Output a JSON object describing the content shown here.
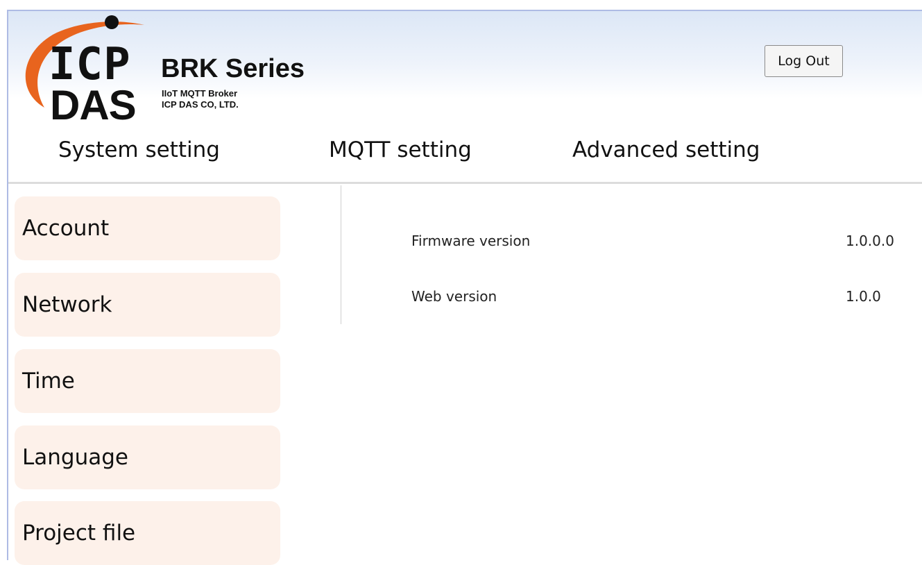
{
  "brand": {
    "logo_top": "ICP",
    "logo_bottom": "DAS",
    "title": "BRK Series",
    "subtitle_line1": "IIoT MQTT Broker",
    "subtitle_line2": "ICP DAS CO, LTD.",
    "swoosh_color": "#e8641e"
  },
  "header": {
    "logout_label": "Log Out"
  },
  "nav": {
    "tabs": [
      {
        "label": "System setting"
      },
      {
        "label": "MQTT setting"
      },
      {
        "label": "Advanced setting"
      }
    ]
  },
  "sidebar": {
    "items": [
      {
        "label": "Account"
      },
      {
        "label": "Network"
      },
      {
        "label": "Time"
      },
      {
        "label": "Language"
      },
      {
        "label": "Project file"
      }
    ]
  },
  "info": {
    "rows": [
      {
        "label": "Firmware version",
        "value": "1.0.0.0"
      },
      {
        "label": "Web version",
        "value": "1.0.0"
      }
    ]
  }
}
